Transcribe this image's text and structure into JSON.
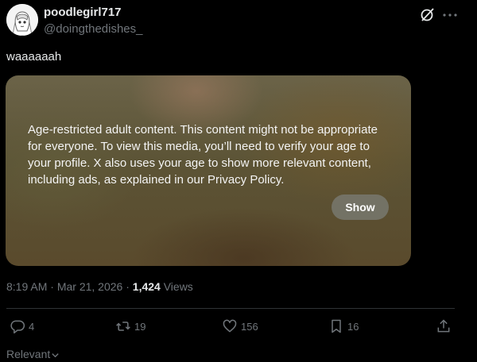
{
  "post": {
    "display_name": "poodlegirl717",
    "handle": "@doingthedishes_",
    "text": "waaaaaah"
  },
  "media": {
    "warning": "Age-restricted adult content. This content might not be appropriate for everyone. To view this media, you’ll need to verify your age to your profile. X also uses your age to show more relevant content, including ads, as explained in our Privacy Policy.",
    "show_label": "Show"
  },
  "meta": {
    "time": "8:19 AM",
    "separator": "·",
    "date": "Mar 21, 2026",
    "views_count": "1,424",
    "views_label": "Views"
  },
  "actions": {
    "replies": "4",
    "reposts": "19",
    "likes": "156",
    "bookmarks": "16"
  },
  "sort": {
    "label": "Relevant"
  },
  "colors": {
    "background": "#000000",
    "text": "#e7e9ea",
    "muted": "#71767b"
  }
}
